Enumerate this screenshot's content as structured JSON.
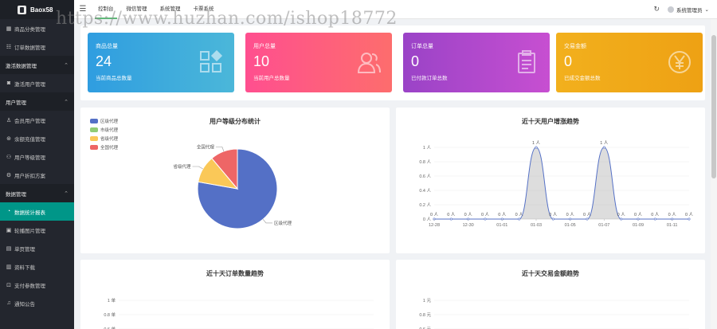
{
  "brand": {
    "name": "Baox58"
  },
  "sidebar": {
    "items": [
      {
        "type": "item",
        "label": "商品分类管理",
        "icon": "grid-icon",
        "name": "sidebar-item-category"
      },
      {
        "type": "item",
        "label": "订单数据管理",
        "icon": "list-icon",
        "name": "sidebar-item-orders"
      },
      {
        "type": "group",
        "label": "激活数据管理",
        "name": "sidebar-group-activation"
      },
      {
        "type": "item",
        "label": "激活用户管理",
        "icon": "user-icon",
        "name": "sidebar-item-activated-users"
      },
      {
        "type": "group",
        "label": "用户管理",
        "name": "sidebar-group-users"
      },
      {
        "type": "item",
        "label": "会员用户管理",
        "icon": "member-icon",
        "name": "sidebar-item-members"
      },
      {
        "type": "item",
        "label": "余额充值管理",
        "icon": "coin-icon",
        "name": "sidebar-item-recharge"
      },
      {
        "type": "item",
        "label": "用户等级管理",
        "icon": "level-icon",
        "name": "sidebar-item-levels"
      },
      {
        "type": "item",
        "label": "用户折扣方案",
        "icon": "gear-icon",
        "name": "sidebar-item-discount"
      },
      {
        "type": "group",
        "label": "数据管理",
        "name": "sidebar-group-data"
      },
      {
        "type": "item",
        "label": "数据统计报表",
        "icon": "chart-icon",
        "name": "sidebar-item-report",
        "active": true
      },
      {
        "type": "item",
        "label": "轮播图片管理",
        "icon": "image-icon",
        "name": "sidebar-item-banner"
      },
      {
        "type": "item",
        "label": "单页管理",
        "icon": "page-icon",
        "name": "sidebar-item-pages"
      },
      {
        "type": "item",
        "label": "资料下载",
        "icon": "download-icon",
        "name": "sidebar-item-downloads"
      },
      {
        "type": "item",
        "label": "支付参数管理",
        "icon": "wallet-icon",
        "name": "sidebar-item-payment"
      },
      {
        "type": "item",
        "label": "通知公告",
        "icon": "bell-icon",
        "name": "sidebar-item-notice"
      }
    ]
  },
  "topbar": {
    "tabs": [
      "控制台",
      "微信管理",
      "系统管理",
      "卡票系统"
    ],
    "active_tab": 0,
    "user": "系统管理员"
  },
  "watermark": "https://www.huzhan.com/ishop18772",
  "stats": [
    {
      "label": "商品总量",
      "value": "24",
      "desc": "当前商品总数量",
      "icon": "apps-icon",
      "color_a": "#2f9de0",
      "color_b": "#4bb7d9"
    },
    {
      "label": "用户总量",
      "value": "10",
      "desc": "当前用户总数量",
      "icon": "users-icon",
      "color_a": "#ff4f8f",
      "color_b": "#fd6d6d"
    },
    {
      "label": "订单总量",
      "value": "0",
      "desc": "已付款订单总数",
      "icon": "clipboard-icon",
      "color_a": "#9a43c7",
      "color_b": "#c74fd1"
    },
    {
      "label": "交易金额",
      "value": "0",
      "desc": "已成交金额总数",
      "icon": "yen-icon",
      "color_a": "#f2b01d",
      "color_b": "#eea114"
    }
  ],
  "chart_data": [
    {
      "type": "pie",
      "title": "用户等级分布统计",
      "legend_position": "top-left",
      "series": [
        {
          "name": "区级代理",
          "value": 7,
          "color": "#5470c6"
        },
        {
          "name": "市级代理",
          "value": 0,
          "color": "#91cc75"
        },
        {
          "name": "省级代理",
          "value": 1,
          "color": "#fac858"
        },
        {
          "name": "全国代理",
          "value": 1,
          "color": "#ee6666"
        }
      ],
      "slice_labels": [
        "区级代理",
        "市级代理",
        "省级代理",
        "全国代理"
      ]
    },
    {
      "type": "area",
      "title": "近十天用户增涨趋势",
      "unit": "人",
      "x_ticks": [
        "12-28",
        "12-30",
        "01-01",
        "01-03",
        "01-05",
        "01-07",
        "01-09",
        "01-11"
      ],
      "x": [
        "12-28",
        "12-29",
        "12-30",
        "12-31",
        "01-01",
        "01-02",
        "01-03",
        "01-04",
        "01-05",
        "01-06",
        "01-07",
        "01-08",
        "01-09",
        "01-10",
        "01-11",
        "01-12"
      ],
      "values": [
        0,
        0,
        0,
        0,
        0,
        0,
        1,
        0,
        0,
        0,
        1,
        0,
        0,
        0,
        0,
        0
      ],
      "point_labels": [
        "0 人",
        "0 人",
        "0 人",
        "0 人",
        "0 人",
        "0 人",
        "1 人",
        "0 人",
        "0 人",
        "0 人",
        "1 人",
        "0 人",
        "0 人",
        "0 人",
        "0 人",
        "0 人"
      ],
      "y_ticks": [
        "0 人",
        "0.2 人",
        "0.4 人",
        "0.6 人",
        "0.8 人",
        "1 人"
      ],
      "ylim": [
        0,
        1
      ]
    },
    {
      "type": "line",
      "title": "近十天订单数量趋势",
      "y_ticks": [
        "0.6 单",
        "0.8 单",
        "1 单"
      ]
    },
    {
      "type": "line",
      "title": "近十天交易金额趋势",
      "y_ticks": [
        "0.6 元",
        "0.8 元",
        "1 元"
      ]
    }
  ]
}
